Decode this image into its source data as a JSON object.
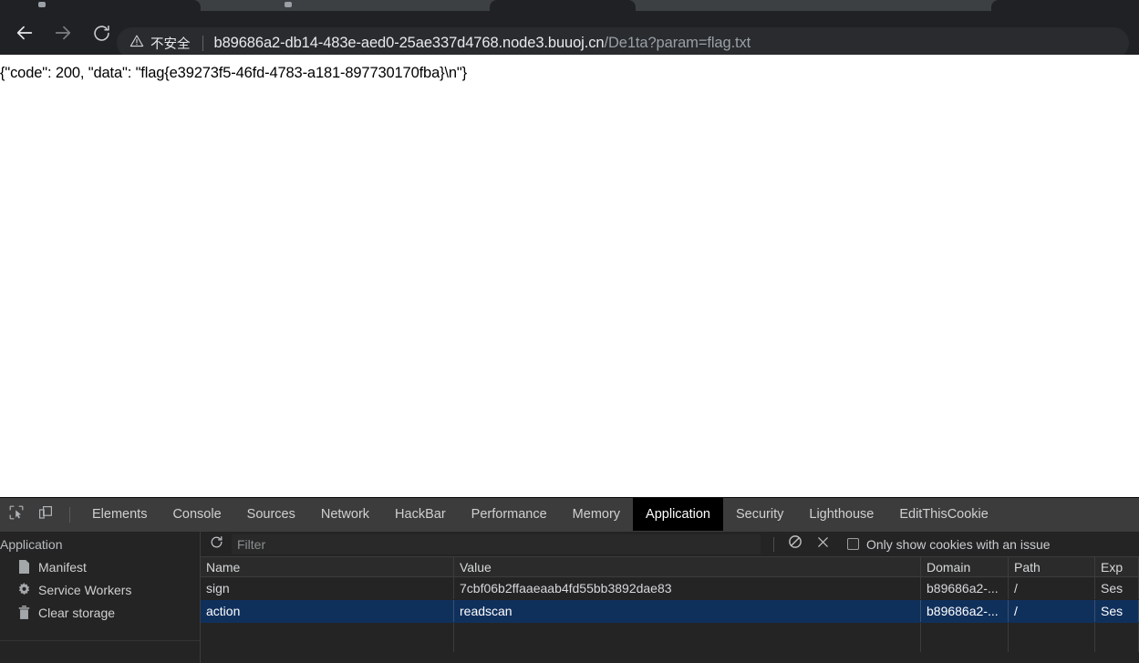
{
  "browser": {
    "back_icon": "arrow-left-icon",
    "forward_icon": "arrow-right-icon",
    "reload_icon": "reload-icon",
    "security_label": "不安全",
    "security_icon": "warning-triangle-icon",
    "url_host": "b89686a2-db14-483e-aed0-25ae337d4768.node3.buuoj.cn",
    "url_path": "/De1ta?param=flag.txt"
  },
  "page": {
    "body_text": "{\"code\": 200, \"data\": \"flag{e39273f5-46fd-4783-a181-897730170fba}\\n\"}"
  },
  "devtools": {
    "inspect_icon": "inspect-element-icon",
    "device_icon": "device-toolbar-icon",
    "tabs": [
      {
        "label": "Elements",
        "active": false
      },
      {
        "label": "Console",
        "active": false
      },
      {
        "label": "Sources",
        "active": false
      },
      {
        "label": "Network",
        "active": false
      },
      {
        "label": "HackBar",
        "active": false
      },
      {
        "label": "Performance",
        "active": false
      },
      {
        "label": "Memory",
        "active": false
      },
      {
        "label": "Application",
        "active": true
      },
      {
        "label": "Security",
        "active": false
      },
      {
        "label": "Lighthouse",
        "active": false
      },
      {
        "label": "EditThisCookie",
        "active": false
      }
    ],
    "sidebar": {
      "header": "Application",
      "items": [
        {
          "label": "Manifest",
          "icon": "document-icon"
        },
        {
          "label": "Service Workers",
          "icon": "gear-icon"
        },
        {
          "label": "Clear storage",
          "icon": "trash-icon"
        }
      ]
    },
    "cookie_toolbar": {
      "refresh_icon": "refresh-icon",
      "filter_placeholder": "Filter",
      "filter_value": "",
      "clear_all_icon": "clear-all-cookies-icon",
      "delete_icon": "delete-cookie-icon",
      "issue_checkbox_label": "Only show cookies with an issue",
      "issue_checkbox_checked": false
    },
    "cookie_table": {
      "columns": [
        "Name",
        "Value",
        "Domain",
        "Path",
        "Exp"
      ],
      "rows": [
        {
          "name": "sign",
          "value": "7cbf06b2ffaaeaab4fd55bb3892dae83",
          "domain": "b89686a2-...",
          "path": "/",
          "expires": "Ses",
          "selected": false
        },
        {
          "name": "action",
          "value": "readscan",
          "domain": "b89686a2-...",
          "path": "/",
          "expires": "Ses",
          "selected": true
        }
      ]
    }
  },
  "colors": {
    "chrome_bg": "#202124",
    "devtools_bg": "#242424",
    "selected_row": "#10305c",
    "active_tab_bg": "#000000"
  }
}
